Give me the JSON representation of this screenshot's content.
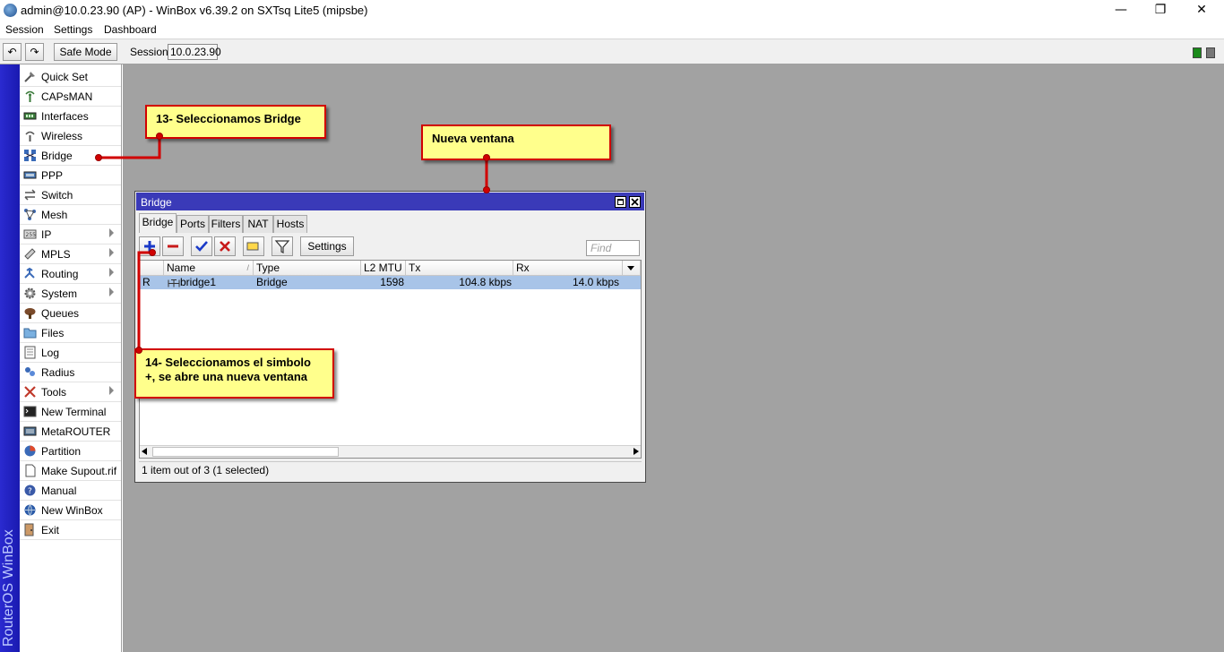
{
  "window": {
    "title": "admin@10.0.23.90 (AP) - WinBox v6.39.2 on SXTsq Lite5 (mipsbe)",
    "minimize": "—",
    "maximize": "❐",
    "close": "✕"
  },
  "menu": {
    "session": "Session",
    "settings": "Settings",
    "dashboard": "Dashboard"
  },
  "toolbar": {
    "undo": "↶",
    "redo": "↷",
    "safe_mode": "Safe Mode",
    "session_label": "Session:",
    "session_value": "10.0.23.90"
  },
  "brand": "RouterOS WinBox",
  "sidebar": {
    "items": [
      {
        "label": "Quick Set",
        "icon": "quick-set-icon"
      },
      {
        "label": "CAPsMAN",
        "icon": "capsman-icon"
      },
      {
        "label": "Interfaces",
        "icon": "interfaces-icon"
      },
      {
        "label": "Wireless",
        "icon": "wireless-icon"
      },
      {
        "label": "Bridge",
        "icon": "bridge-icon"
      },
      {
        "label": "PPP",
        "icon": "ppp-icon"
      },
      {
        "label": "Switch",
        "icon": "switch-icon"
      },
      {
        "label": "Mesh",
        "icon": "mesh-icon"
      },
      {
        "label": "IP",
        "icon": "ip-icon"
      },
      {
        "label": "MPLS",
        "icon": "mpls-icon"
      },
      {
        "label": "Routing",
        "icon": "routing-icon"
      },
      {
        "label": "System",
        "icon": "system-icon"
      },
      {
        "label": "Queues",
        "icon": "queues-icon"
      },
      {
        "label": "Files",
        "icon": "files-icon"
      },
      {
        "label": "Log",
        "icon": "log-icon"
      },
      {
        "label": "Radius",
        "icon": "radius-icon"
      },
      {
        "label": "Tools",
        "icon": "tools-icon"
      },
      {
        "label": "New Terminal",
        "icon": "terminal-icon"
      },
      {
        "label": "MetaROUTER",
        "icon": "metarouter-icon"
      },
      {
        "label": "Partition",
        "icon": "partition-icon"
      },
      {
        "label": "Make Supout.rif",
        "icon": "supout-icon"
      },
      {
        "label": "Manual",
        "icon": "manual-icon"
      },
      {
        "label": "New WinBox",
        "icon": "winbox-icon"
      },
      {
        "label": "Exit",
        "icon": "exit-icon"
      }
    ]
  },
  "bridge_window": {
    "title": "Bridge",
    "tabs": [
      "Bridge",
      "Ports",
      "Filters",
      "NAT",
      "Hosts"
    ],
    "settings_label": "Settings",
    "find_placeholder": "Find",
    "columns": [
      "Name",
      "Type",
      "L2 MTU",
      "Tx",
      "Rx"
    ],
    "rows": [
      {
        "flag": "R",
        "name": "bridge1",
        "type": "Bridge",
        "l2mtu": "1598",
        "tx": "104.8 kbps",
        "rx": "14.0 kbps"
      }
    ],
    "status": "1 item out of 3 (1 selected)"
  },
  "callouts": {
    "c13": "13- Seleccionamos Bridge",
    "nueva": "Nueva ventana",
    "c14_line1": "14- Seleccionamos el simbolo",
    "c14_line2": "+, se abre una nueva ventana"
  },
  "colors": {
    "accent": "#3a3ab8",
    "callout_bg": "#ffff8c",
    "callout_border": "#d10000",
    "selected_row": "#a8c4e8",
    "desktop": "#a2a2a2"
  }
}
